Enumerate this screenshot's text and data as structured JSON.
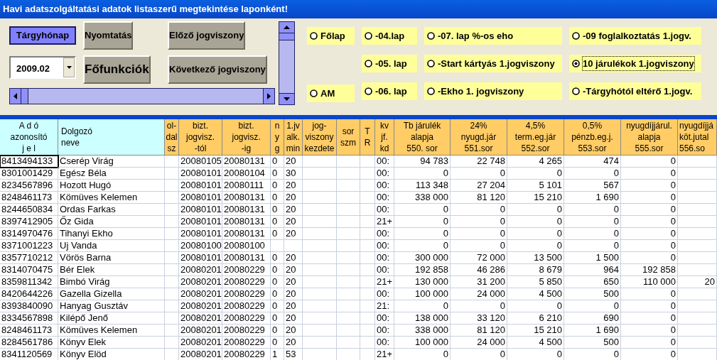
{
  "window": {
    "title": "Havi adatszolgáltatási adatok listaszerű megtekintése laponként!"
  },
  "controls": {
    "month_label": "Tárgyhónap",
    "month_value": "2009.02",
    "buttons": [
      "Nyomtatás",
      "Előző jogviszony",
      "Főfunkciók",
      "Következő jogviszony"
    ]
  },
  "page_options": [
    [
      {
        "label": "Főlap",
        "selected": false
      },
      {
        "label": "AM",
        "selected": false
      }
    ],
    [
      {
        "label": "-04.lap",
        "selected": false
      },
      {
        "label": "-05. lap",
        "selected": false
      },
      {
        "label": "-06. lap",
        "selected": false
      }
    ],
    [
      {
        "label": "-07. lap %-os eho",
        "selected": false
      },
      {
        "label": "-Start kártyás 1.jogviszony",
        "selected": false
      },
      {
        "label": "-Ekho 1. jogviszony",
        "selected": false
      }
    ],
    [
      {
        "label": "-09 foglalkoztatás 1.jogv.",
        "selected": false
      },
      {
        "label": "10 járulékok 1.jogviszony",
        "selected": true
      },
      {
        "label": "-Tárgyhótól eltérő 1.jogv.",
        "selected": false
      }
    ]
  ],
  "table": {
    "columns": [
      "A d ó\nazonosító\nj e l",
      "Dolgozó\n neve",
      "ol-\ndal\nsz",
      "bizt.\njogvisz.\n-tól",
      "bizt.\njogvisz.\n-ig",
      "n\ny\ng",
      "1.jv\nalk.\nmin",
      "jog-\nviszony\nkezdete",
      "sor\nszm",
      "T\nR",
      "kv\njf.\nkd",
      "Tb járulék\nalapja\n550. sor",
      "24%\nnyugd.jár\n551.sor",
      "4,5%\nterm.eg.jár\n552.sor",
      "0,5%\npénzb.eg.j.\n553.sor",
      "nyugdíjjárul.\nalapja\n555.sor",
      "nyugdíjjá\nköt.jutal\n556.so"
    ],
    "rows": [
      {
        "selected": true,
        "cells": [
          "8413494133",
          "Cserép Virág",
          null,
          "20080105",
          "20080131",
          "0",
          "20",
          null,
          null,
          null,
          "00:",
          "94 783",
          "22 748",
          "4 265",
          "474",
          "0",
          null
        ]
      },
      {
        "selected": false,
        "cells": [
          "8301001429",
          "Egész Béla",
          null,
          "20080101",
          "20080104",
          "0",
          "30",
          null,
          null,
          null,
          "00:",
          "0",
          "0",
          "0",
          "0",
          "0",
          null
        ]
      },
      {
        "selected": false,
        "cells": [
          "8234567896",
          "Hozott Hugó",
          null,
          "20080101",
          "20080111",
          "0",
          "20",
          null,
          null,
          null,
          "00:",
          "113 348",
          "27 204",
          "5 101",
          "567",
          "0",
          null
        ]
      },
      {
        "selected": false,
        "cells": [
          "8248461173",
          "Kömüves Kelemen",
          null,
          "20080101",
          "20080131",
          "0",
          "20",
          null,
          null,
          null,
          "00:",
          "338 000",
          "81 120",
          "15 210",
          "1 690",
          "0",
          null
        ]
      },
      {
        "selected": false,
        "cells": [
          "8244650834",
          "Ordas Farkas",
          null,
          "20080101",
          "20080131",
          "0",
          "20",
          null,
          null,
          null,
          "00:",
          "0",
          "0",
          "0",
          "0",
          "0",
          null
        ]
      },
      {
        "selected": false,
        "cells": [
          "8397412905",
          "Őz Gida",
          null,
          "20080101",
          "20080131",
          "0",
          "20",
          null,
          null,
          null,
          "21+",
          "0",
          "0",
          "0",
          "0",
          "0",
          null
        ]
      },
      {
        "selected": false,
        "cells": [
          "8314970476",
          "Tihanyi Ekho",
          null,
          "20080101",
          "20080131",
          "0",
          "20",
          null,
          null,
          null,
          "00:",
          "0",
          "0",
          "0",
          "0",
          "0",
          null
        ]
      },
      {
        "selected": false,
        "cells": [
          "8371001223",
          "Uj Vanda",
          null,
          "20080100",
          "20080100",
          null,
          null,
          null,
          null,
          null,
          "00:",
          "0",
          "0",
          "0",
          "0",
          "0",
          null
        ]
      },
      {
        "selected": false,
        "cells": [
          "8357710212",
          "Vörös Barna",
          null,
          "20080101",
          "20080131",
          "0",
          "20",
          null,
          null,
          null,
          "00:",
          "300 000",
          "72 000",
          "13 500",
          "1 500",
          "0",
          null
        ]
      },
      {
        "selected": false,
        "cells": [
          "8314070475",
          "Bér Elek",
          null,
          "20080201",
          "20080229",
          "0",
          "20",
          null,
          null,
          null,
          "00:",
          "192 858",
          "46 286",
          "8 679",
          "964",
          "192 858",
          null
        ]
      },
      {
        "selected": false,
        "cells": [
          "8359811342",
          "Bimbó Virág",
          null,
          "20080201",
          "20080229",
          "0",
          "20",
          null,
          null,
          null,
          "21+",
          "130 000",
          "31 200",
          "5 850",
          "650",
          "110 000",
          "20"
        ]
      },
      {
        "selected": false,
        "cells": [
          "8420644226",
          "Gazella Gizella",
          null,
          "20080201",
          "20080229",
          "0",
          "20",
          null,
          null,
          null,
          "00:",
          "100 000",
          "24 000",
          "4 500",
          "500",
          "0",
          null
        ]
      },
      {
        "selected": false,
        "cells": [
          "8393840090",
          "Hanyag Gusztáv",
          null,
          "20080201",
          "20080229",
          "0",
          "20",
          null,
          null,
          null,
          "21:",
          "0",
          "0",
          "0",
          "0",
          "0",
          null
        ]
      },
      {
        "selected": false,
        "cells": [
          "8334567898",
          "Kilépő Jenő",
          null,
          "20080201",
          "20080229",
          "0",
          "20",
          null,
          null,
          null,
          "00:",
          "138 000",
          "33 120",
          "6 210",
          "690",
          "0",
          null
        ]
      },
      {
        "selected": false,
        "cells": [
          "8248461173",
          "Kömüves Kelemen",
          null,
          "20080201",
          "20080229",
          "0",
          "20",
          null,
          null,
          null,
          "00:",
          "338 000",
          "81 120",
          "15 210",
          "1 690",
          "0",
          null
        ]
      },
      {
        "selected": false,
        "cells": [
          "8284561786",
          "Könyv Elek",
          null,
          "20080201",
          "20080229",
          "0",
          "20",
          null,
          null,
          null,
          "00:",
          "100 000",
          "24 000",
          "4 500",
          "500",
          "0",
          null
        ]
      },
      {
        "selected": false,
        "cells": [
          "8341120569",
          "Könyv Elöd",
          null,
          "20080201",
          "20080229",
          "1",
          "53",
          null,
          null,
          null,
          "21+",
          "0",
          "0",
          "0",
          "0",
          "0",
          null
        ]
      }
    ]
  }
}
